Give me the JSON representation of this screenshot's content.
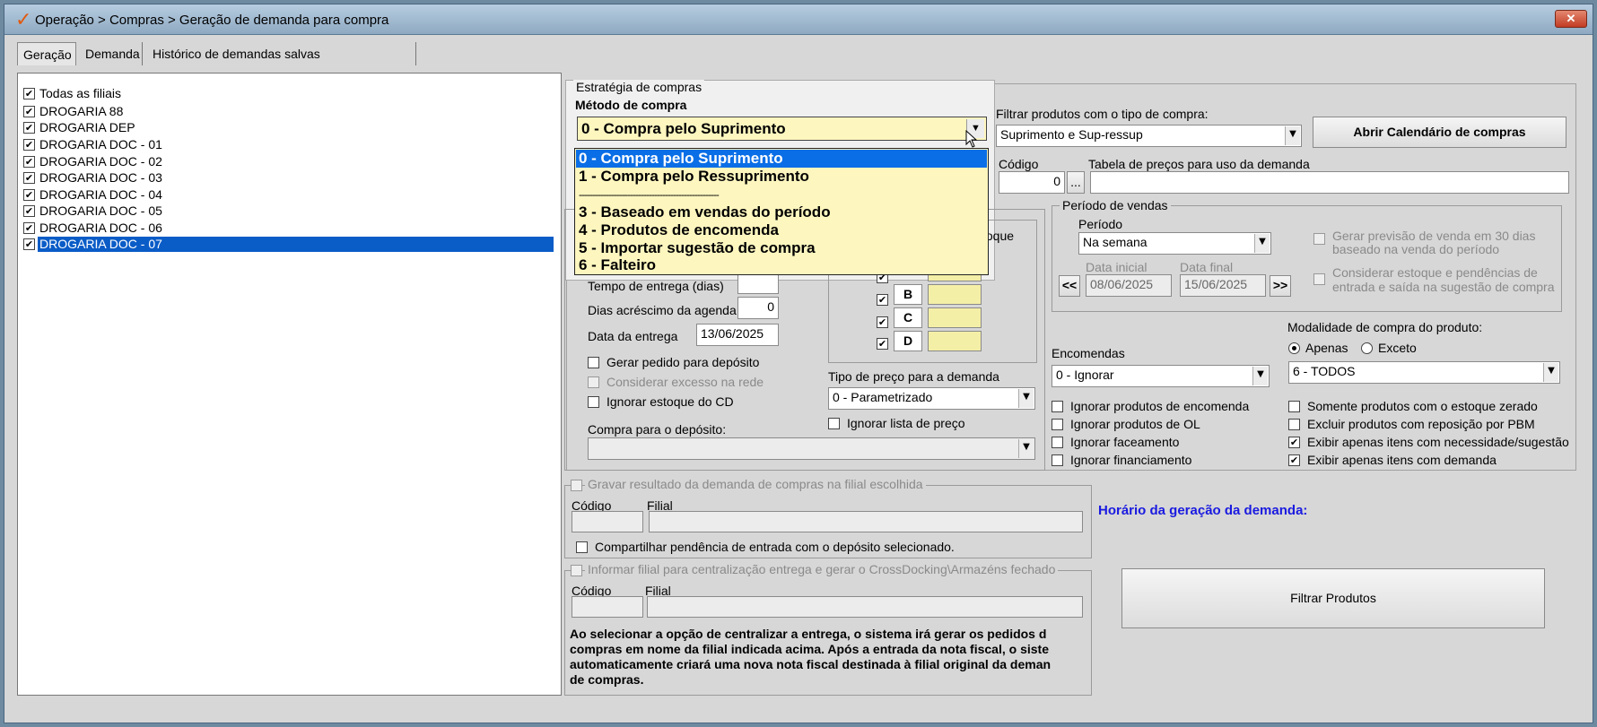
{
  "window": {
    "title": "Operação > Compras > Geração de demanda para compra",
    "close_label": "✕"
  },
  "tabs": [
    {
      "label": "Geração"
    },
    {
      "label": "Demanda"
    },
    {
      "label": "Histórico de demandas salvas temporariamente"
    }
  ],
  "filiais": {
    "all_label": "Todas as filiais",
    "items": [
      {
        "label": "DROGARIA 88",
        "checked": true
      },
      {
        "label": "DROGARIA DEP",
        "checked": true
      },
      {
        "label": "DROGARIA DOC - 01",
        "checked": true
      },
      {
        "label": "DROGARIA DOC - 02",
        "checked": true
      },
      {
        "label": "DROGARIA DOC - 03",
        "checked": true
      },
      {
        "label": "DROGARIA DOC - 04",
        "checked": true
      },
      {
        "label": "DROGARIA DOC - 05",
        "checked": true
      },
      {
        "label": "DROGARIA DOC - 06",
        "checked": true
      },
      {
        "label": "DROGARIA DOC - 07",
        "checked": true,
        "selected": true
      }
    ]
  },
  "estrategia": {
    "group_title": "Estratégia de compras",
    "metodo_label": "Método de compra",
    "metodo_value": "0 - Compra pelo Suprimento",
    "options": [
      "0 - Compra pelo Suprimento",
      "1 - Compra pelo Ressuprimento",
      "----------------------------------------------------",
      "3 - Baseado em vendas do período",
      "4 - Produtos de encomenda",
      "5 - Importar sugestão de compra",
      "6 - Falteiro"
    ],
    "estoque_partial": "toque",
    "tempo_entrega_label": "Tempo de entrega (dias)",
    "dias_acrescimo_label": "Dias acréscimo da agenda",
    "dias_acrescimo_value": "0",
    "data_entrega_label": "Data da entrega",
    "data_entrega_value": "13/06/2025",
    "gerar_pedido_label": "Gerar pedido para depósito",
    "considerar_excesso_label": "Considerar excesso na rede",
    "ignorar_estoque_cd_label": "Ignorar estoque do CD",
    "compra_deposito_label": "Compra para o depósito:",
    "curvas": [
      {
        "letter": "B"
      },
      {
        "letter": "C"
      },
      {
        "letter": "D"
      }
    ],
    "tipo_preco_label": "Tipo de preço para a demanda",
    "tipo_preco_value": "0 - Parametrizado",
    "ignorar_lista_label": "Ignorar lista de preço"
  },
  "filtro": {
    "tipo_compra_label": "Filtrar produtos com o tipo de compra:",
    "tipo_compra_value": "Suprimento e Sup-ressup",
    "calendario_button": "Abrir Calendário de compras",
    "codigo_label": "Código",
    "codigo_value": "0",
    "lookup_button": "...",
    "tabela_label": "Tabela de preços para uso da demanda"
  },
  "periodo": {
    "group_title": "Período de vendas",
    "periodo_label": "Período",
    "periodo_value": "Na semana",
    "data_inicial_label": "Data inicial",
    "data_inicial_value": "08/06/2025",
    "data_final_label": "Data final",
    "data_final_value": "15/06/2025",
    "prev_button": "<<",
    "next_button": ">>",
    "gerar_previsao_line1": "Gerar previsão de venda em 30 dias",
    "gerar_previsao_line2": "baseado na venda do período",
    "considerar_estoque_line1": "Considerar estoque e pendências de",
    "considerar_estoque_line2": "entrada e saída  na sugestão de compra"
  },
  "modalidade": {
    "label": "Modalidade de compra do produto:",
    "apenas_label": "Apenas",
    "exceto_label": "Exceto",
    "value": "6 - TODOS"
  },
  "encomendas": {
    "label": "Encomendas",
    "value": "0 - Ignorar"
  },
  "ignorar": {
    "produtos_encomenda": "Ignorar produtos de encomenda",
    "produtos_ol": "Ignorar produtos de OL",
    "faceamento": "Ignorar faceamento",
    "financiamento": "Ignorar financiamento"
  },
  "exibir": {
    "estoque_zerado": "Somente produtos com o estoque zerado",
    "excluir_pbm": "Excluir produtos com reposição por PBM",
    "necessidade": "Exibir apenas itens com necessidade/sugestão",
    "demanda": "Exibir apenas itens com demanda"
  },
  "gravar": {
    "title": "Gravar resultado da demanda de compras na filial escolhida",
    "codigo_label": "Código",
    "filial_label": "Filial",
    "compartilhar_label": "Compartilhar pendência de entrada com o depósito selecionado."
  },
  "centralizar": {
    "title": "Informar filial para centralização entrega e gerar o CrossDocking\\Armazéns fechado",
    "codigo_label": "Código",
    "filial_label": "Filial",
    "info_line1": "Ao selecionar a opção de centralizar a entrega, o sistema irá gerar os pedidos d",
    "info_line2": "compras em nome da filial indicada acima. Após a entrada da nota fiscal, o siste",
    "info_line3": "automaticamente criará uma nova nota fiscal destinada à filial original da deman",
    "info_line4": "de compras."
  },
  "horario_label": "Horário da geração da demanda:",
  "filtrar_button": "Filtrar Produtos",
  "colors": {
    "accent": "#0a5cc7",
    "horario": "#1a1ae0",
    "yellow": "#fdf6bf"
  }
}
